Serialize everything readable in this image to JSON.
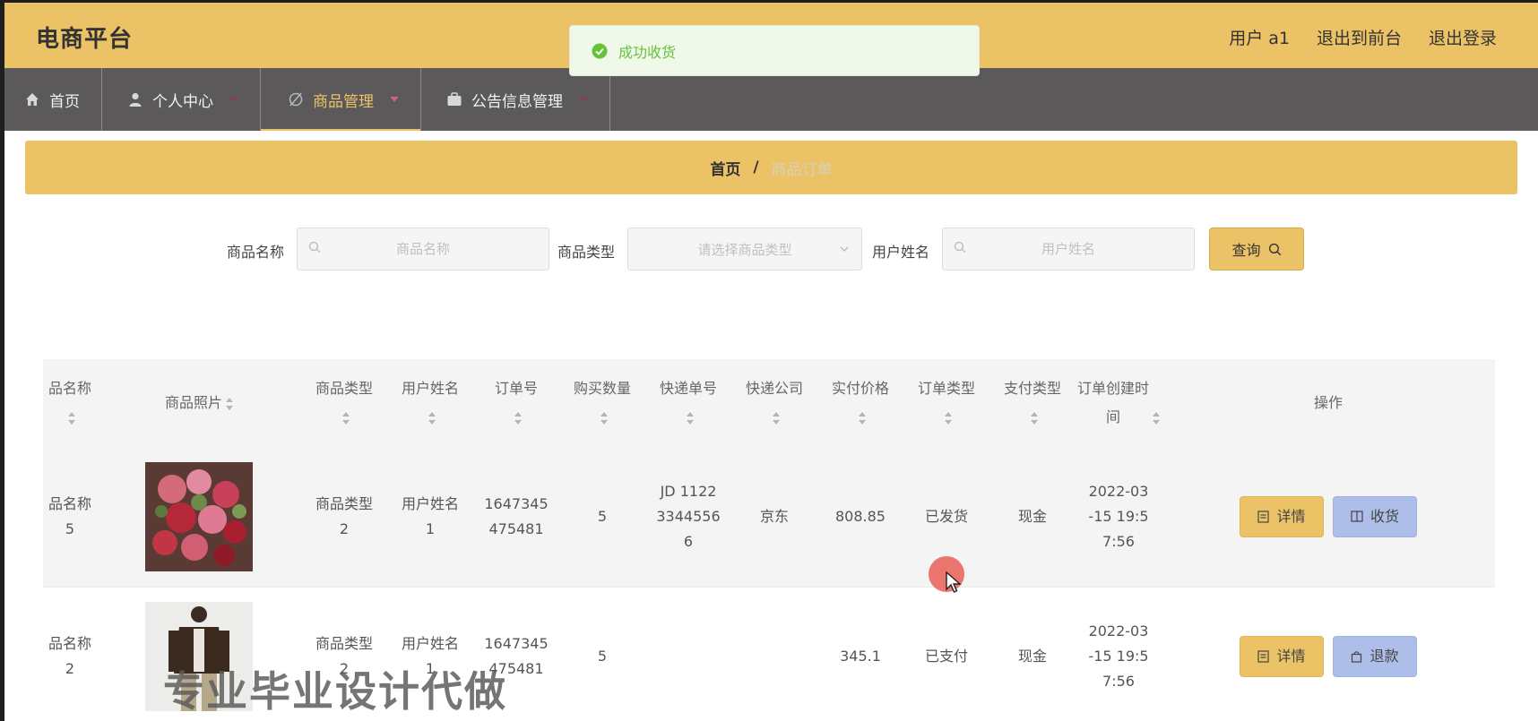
{
  "app": {
    "title": "电商平台"
  },
  "header": {
    "user_label": "用户 a1",
    "exit_front": "退出到前台",
    "logout": "退出登录"
  },
  "toast": {
    "message": "成功收货"
  },
  "nav": {
    "items": [
      {
        "label": "首页",
        "icon": "home-icon"
      },
      {
        "label": "个人中心",
        "icon": "user-icon"
      },
      {
        "label": "商品管理",
        "icon": "goods-icon"
      },
      {
        "label": "公告信息管理",
        "icon": "notice-icon"
      }
    ]
  },
  "breadcrumb": {
    "home": "首页",
    "sep": "/",
    "current": "商品订单"
  },
  "search": {
    "name_label": "商品名称",
    "name_placeholder": "商品名称",
    "type_label": "商品类型",
    "type_placeholder": "请选择商品类型",
    "user_label": "用户姓名",
    "user_placeholder": "用户姓名",
    "query_label": "查询"
  },
  "table": {
    "headers": {
      "goods_name": "品名称",
      "photo": "商品照片",
      "goods_type": "商品类型",
      "user_name": "用户姓名",
      "order_no": "订单号",
      "quantity": "购买数量",
      "express_no": "快递单号",
      "express_company": "快递公司",
      "price": "实付价格",
      "order_type": "订单类型",
      "pay_type": "支付类型",
      "create_time": "订单创建时间",
      "actions": "操作"
    },
    "rows": [
      {
        "goods_name_a": "品名称",
        "goods_name_b": "5",
        "goods_type_a": "商品类型",
        "goods_type_b": "2",
        "user_name_a": "用户姓名",
        "user_name_b": "1",
        "order_no_a": "1647345",
        "order_no_b": "475481",
        "quantity": "5",
        "express_a": "JD 1122",
        "express_b": "3344556",
        "express_c": "6",
        "company": "京东",
        "price": "808.85",
        "order_type": "已发货",
        "pay_type": "现金",
        "time_a": "2022-03",
        "time_b": "-15 19:5",
        "time_c": "7:56",
        "detail_label": "详情",
        "action_label": "收货"
      },
      {
        "goods_name_a": "品名称",
        "goods_name_b": "2",
        "goods_type_a": "商品类型",
        "goods_type_b": "2",
        "user_name_a": "用户姓名",
        "user_name_b": "1",
        "order_no_a": "1647345",
        "order_no_b": "475481",
        "quantity": "5",
        "express_a": "",
        "express_b": "",
        "express_c": "",
        "company": "",
        "price": "345.1",
        "order_type": "已支付",
        "pay_type": "现金",
        "time_a": "2022-03",
        "time_b": "-15 19:5",
        "time_c": "7:56",
        "detail_label": "详情",
        "action_label": "退款"
      }
    ]
  },
  "watermark": "专业毕业设计代做",
  "colors": {
    "primary": "#ecc266",
    "nav_bg": "#5b5959",
    "action_blue": "#adbfe8",
    "success": "#67c23a"
  }
}
